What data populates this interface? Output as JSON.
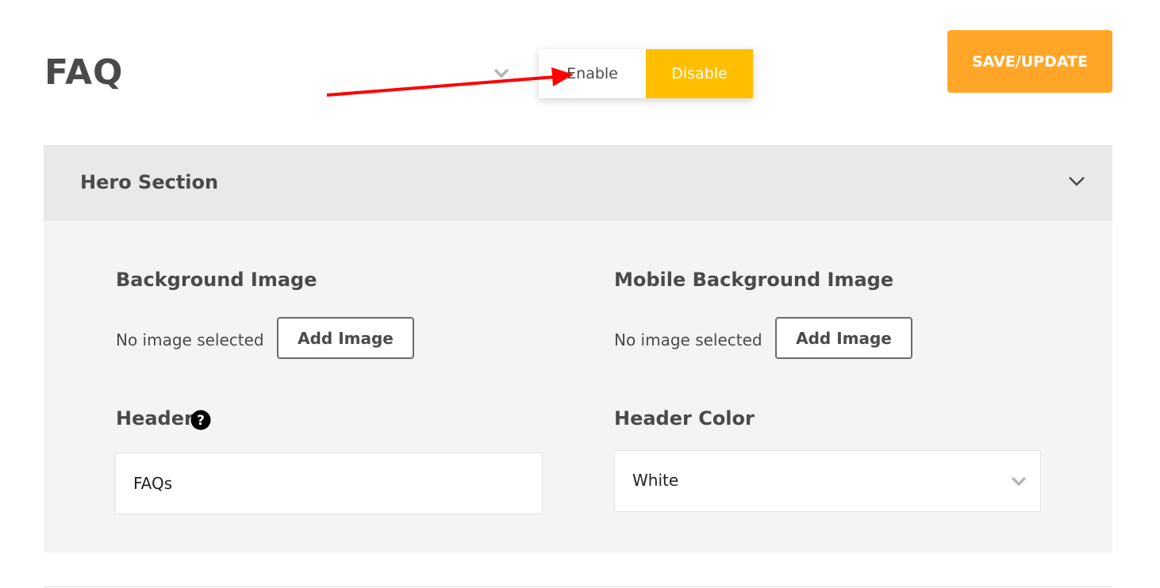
{
  "page": {
    "title": "FAQ"
  },
  "status_toggle": {
    "enable_label": "Enable",
    "disable_label": "Disable",
    "selected": "Disable"
  },
  "toolbar": {
    "save_label": "SAVE/UPDATE"
  },
  "hero_section": {
    "title": "Hero Section",
    "background_image": {
      "label": "Background Image",
      "status": "No image selected",
      "button": "Add Image"
    },
    "mobile_background_image": {
      "label": "Mobile Background Image",
      "status": "No image selected",
      "button": "Add Image"
    },
    "header": {
      "label": "Header",
      "value": "FAQs"
    },
    "header_color": {
      "label": "Header Color",
      "value": "White"
    }
  },
  "colors": {
    "accent_orange": "#ffa629",
    "toggle_active": "#ffbf00",
    "annotation_arrow": "#ff0000"
  }
}
